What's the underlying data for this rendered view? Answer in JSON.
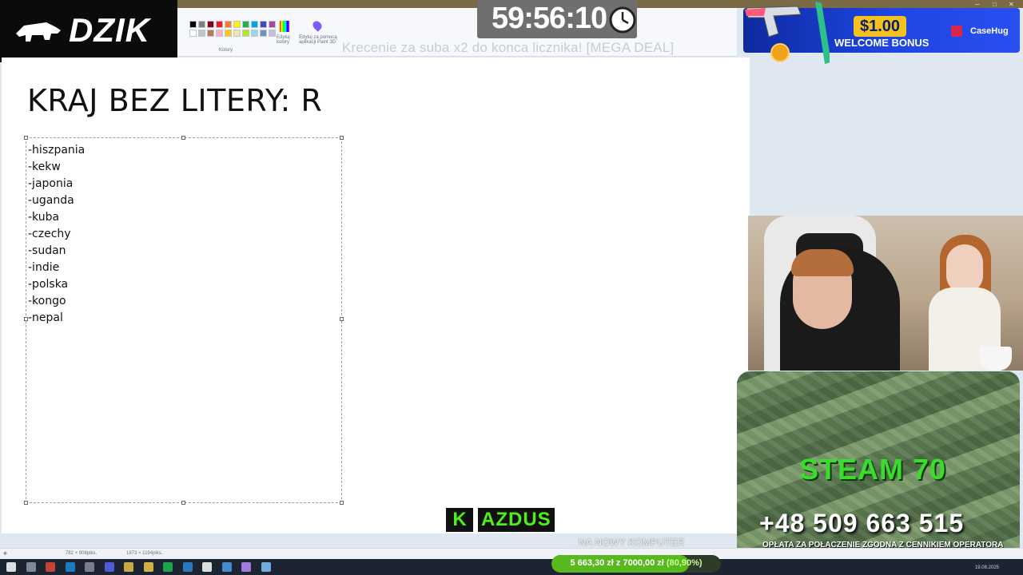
{
  "overlay": {
    "logo_text": "DZIK",
    "countdown": "59:56:10",
    "ticker": "Krecenie za suba x2 do konca licznika! [MEGA DEAL]",
    "bonus_amount": "$1.00",
    "bonus_label": "WELCOME BONUS",
    "bonus_brand": "CaseHug",
    "kick_letter": "K",
    "kick_name": "AZDUS",
    "goal_label": "NA NOWY KOMPUTER",
    "donation_text": "5 663,30 zł z 7000,00 zł",
    "donation_percent": "(80,90%)",
    "donation_fraction": 0.809,
    "ad_title": "STEAM 70",
    "ad_phone": "+48 509 663 515",
    "ad_note": "OPŁATA ZA POŁĄCZENIE ZGODNA Z CENNIKIEM OPERATORA"
  },
  "paint": {
    "ribbon": {
      "colors_label": "Kolory",
      "edit_colors": "Edytuj kolory",
      "paint3d_label": "Edytuj za pomocą aplikacji Paint 3D",
      "palette": [
        "#000000",
        "#7f7f7f",
        "#880015",
        "#ed1c24",
        "#ff7f27",
        "#fff200",
        "#22b14c",
        "#00a2e8",
        "#3f48cc",
        "#a349a4",
        "#ffffff",
        "#c3c3c3",
        "#b97a57",
        "#ffaec9",
        "#ffc90e",
        "#efe4b0",
        "#b5e61d",
        "#99d9ea",
        "#7092be",
        "#c8bfe7"
      ]
    },
    "heading": "KRAJ BEZ LITERY: R",
    "list": [
      "-hiszpania",
      "-kekw",
      "-japonia",
      "-uganda",
      "-kuba",
      "-czechy",
      "-sudan",
      "-indie",
      "-polska",
      "-kongo",
      "-nepal"
    ],
    "status": {
      "selection_size": "782 × 908piks.",
      "canvas_size": "1873 × 1194piks."
    }
  },
  "taskbar": {
    "date": "19.08.2025",
    "icons": [
      "start-icon",
      "search-icon",
      "opera-icon",
      "edge-icon",
      "vpn-icon",
      "discord-icon",
      "chrome-icon",
      "file-explorer-icon",
      "spotify-icon",
      "mail-icon",
      "notion-icon",
      "paint-icon",
      "app-icon",
      "paint-active-icon"
    ]
  }
}
